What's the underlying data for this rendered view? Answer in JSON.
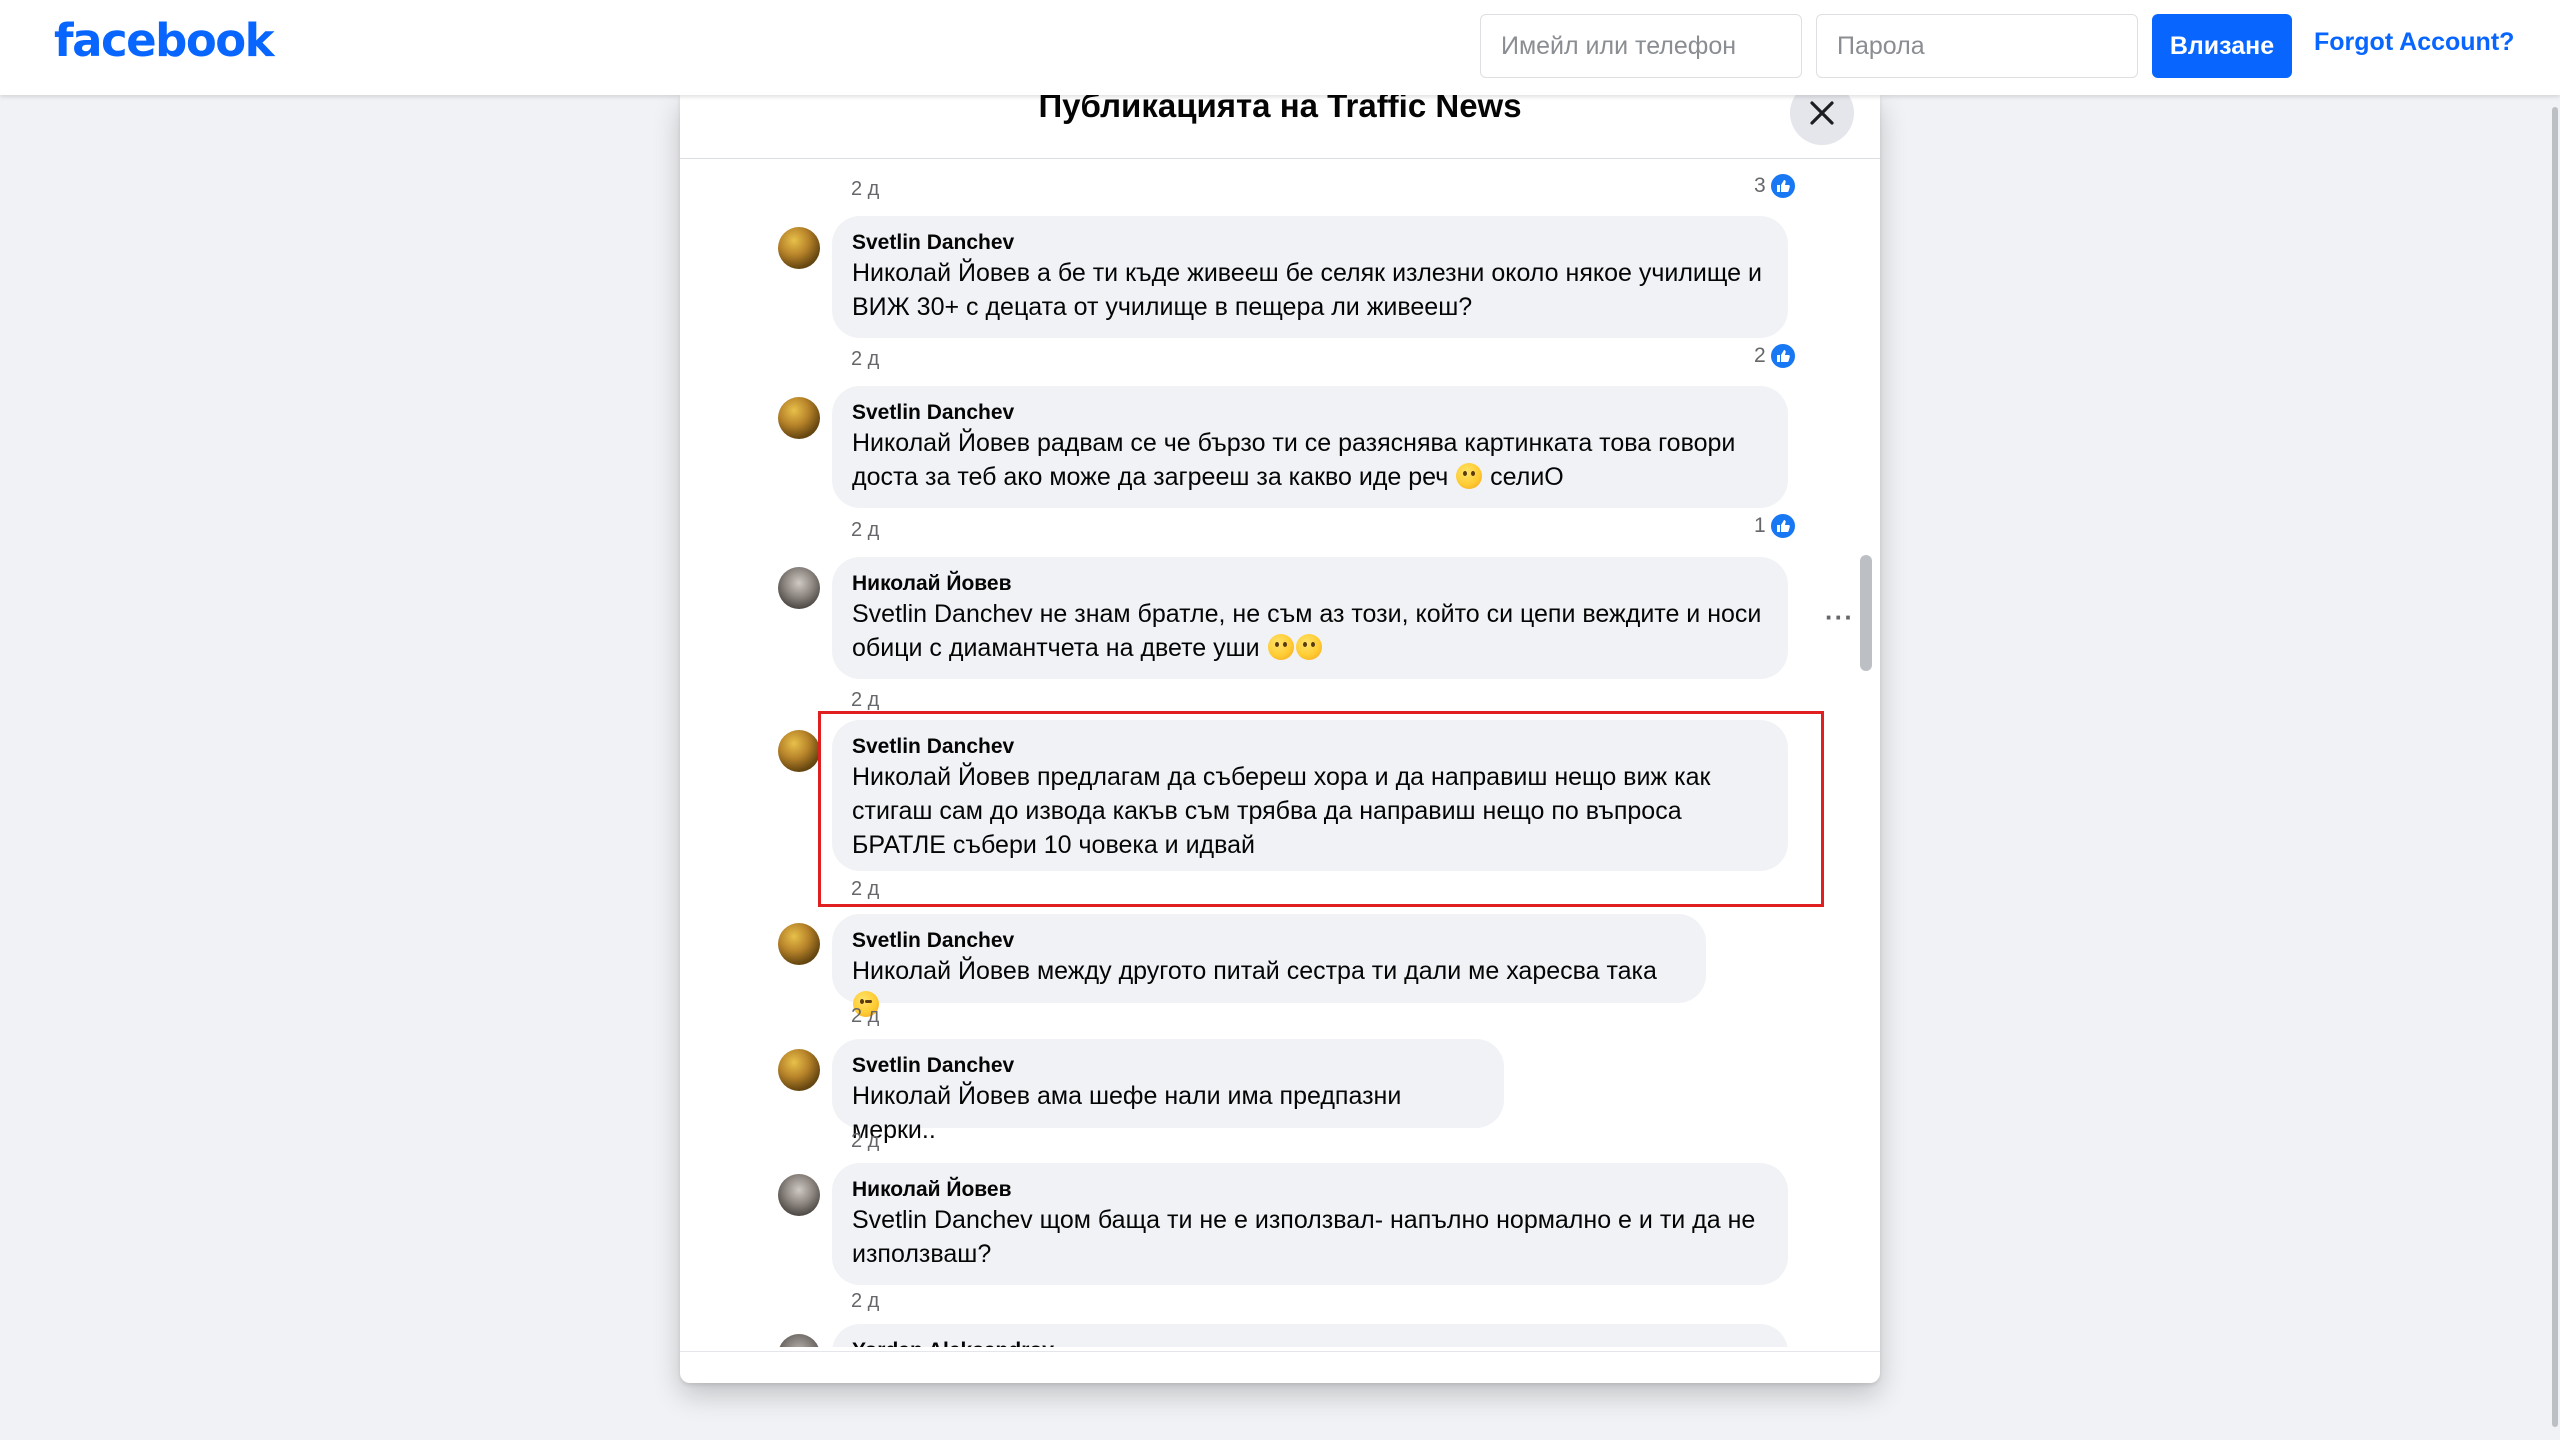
{
  "topbar": {
    "logo_text": "facebook",
    "email_placeholder": "Имейл или телефон",
    "password_placeholder": "Парола",
    "login_label": "Влизане",
    "forgot_label": "Forgot Account?"
  },
  "modal": {
    "title": "Публикацията на Traffic News"
  },
  "comments": [
    {
      "author": "",
      "time": "2 д",
      "likes": "3"
    },
    {
      "author": "Svetlin Danchev",
      "text_line1": "Николай Йовев а бе ти къде живееш бе селяк излезни около някое училище и",
      "text_line2": "ВИЖ 30+ с децата от училище в пещера ли живееш?",
      "time": "2 д",
      "likes": "2"
    },
    {
      "author": "Svetlin Danchev",
      "text_line1": "Николай Йовев радвам се че бързо ти се разяснява картинката това говори",
      "text_line2": "доста за теб ако може да загрееш за какво иде реч",
      "text_line2_tail": "селиО",
      "time": "2 д",
      "likes": "1"
    },
    {
      "author": "Николай Йовев",
      "text_line1": "Svetlin Danchev не знам братле, не съм аз този, който си цепи веждите и носи",
      "text_line2": "обици с диамантчета на двете уши",
      "time": "2 д"
    },
    {
      "author": "Svetlin Danchev",
      "text_line1": "Николай Йовев предлагам да събереш хора и да направиш нещо виж как",
      "text_line2": "стигаш сам до извода какъв съм трябва да направиш нещо по въпроса",
      "text_line3": "БРАТЛЕ събери 10 човека и идвай",
      "time": "2 д"
    },
    {
      "author": "Svetlin Danchev",
      "text_line1": "Николай Йовев между другото питай сестра ти дали ме харесва така",
      "time": "2 д"
    },
    {
      "author": "Svetlin Danchev",
      "text_line1": "Николай Йовев ама шефе нали има предпазни мерки..",
      "time": "2 д"
    },
    {
      "author": "Николай Йовев",
      "text_line1": "Svetlin Danchev щом баща ти не е използвал- напълно нормално е и ти да не",
      "text_line2": "използваш?",
      "time": "2 д"
    },
    {
      "author": "Yordan Aleksandrov"
    }
  ],
  "colors": {
    "brand": "#0866ff",
    "bubble": "#f0f2f5",
    "highlight": "#e02020",
    "like": "#1877f2"
  }
}
